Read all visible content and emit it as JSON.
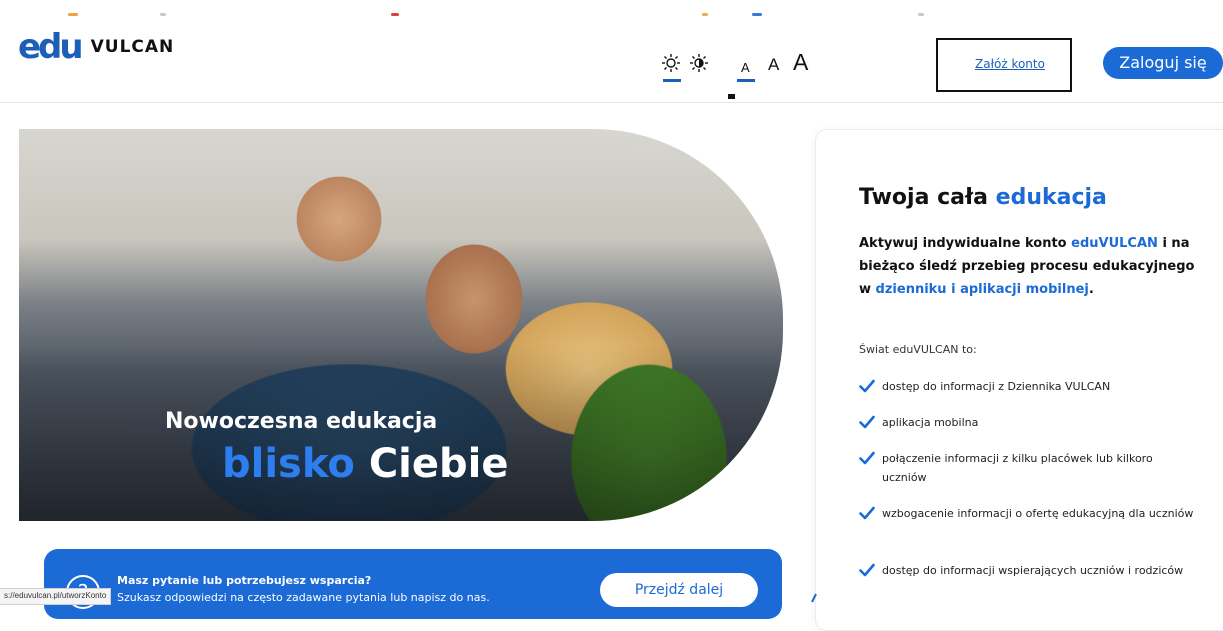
{
  "header": {
    "logo_mark": "edu",
    "logo_text": "VULCAN",
    "font_size_small": "A",
    "font_size_medium": "A",
    "font_size_large": "A",
    "register_label": "Załóż konto",
    "login_label": "Zaloguj się"
  },
  "hero": {
    "line1": "Nowoczesna edukacja",
    "line2_blue": "blisko",
    "line2_white": "Ciebie"
  },
  "support": {
    "title": "Masz pytanie lub potrzebujesz wsparcia?",
    "subtitle": "Szukasz odpowiedzi na często zadawane pytania lub napisz do nas.",
    "button_label": "Przejdź dalej",
    "icon_char": "?"
  },
  "status_bar": {
    "url": "s://eduvulcan.pl/utworzKonto"
  },
  "card": {
    "title_plain": "Twoja cała",
    "title_blue": "edukacja",
    "intro_1": "Aktywuj indywidualne konto",
    "intro_brand": "eduVULCAN",
    "intro_2": "i na bieżąco śledź przebieg procesu edukacyjnego w",
    "intro_blue": "dzienniku i aplikacji mobilnej",
    "intro_end": ".",
    "world_label": "Świat eduVULCAN to:",
    "features": [
      "dostęp do informacji z Dziennika VULCAN",
      "aplikacja mobilna",
      "połączenie informacji z kilku placówek lub kilkoro uczniów",
      "wzbogacenie informacji o ofertę edukacyjną dla uczniów",
      "dostęp do informacji wspierających uczniów i rodziców"
    ]
  },
  "colors": {
    "brand_blue": "#1b6ad6",
    "logo_blue": "#1b5fb9",
    "check_blue": "#1b6ad6"
  }
}
